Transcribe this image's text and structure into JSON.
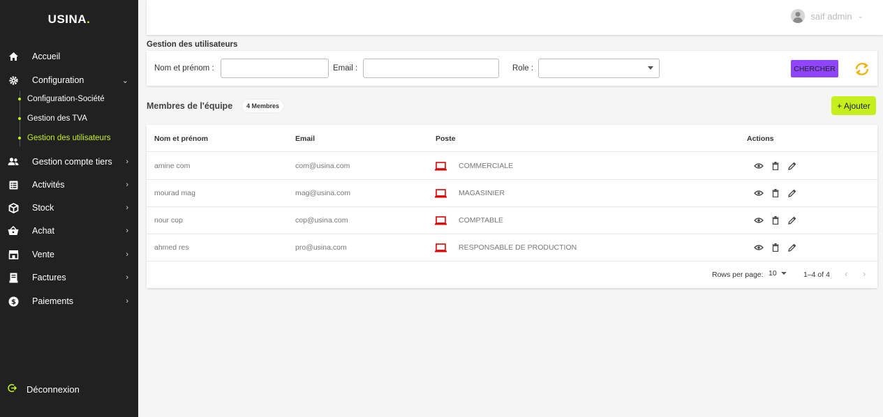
{
  "app": {
    "logo_text": "USINA",
    "logo_dot": "."
  },
  "sidebar": {
    "items": [
      {
        "label": "Accueil",
        "icon": "home-icon"
      },
      {
        "label": "Configuration",
        "icon": "gear-icon",
        "chevron": "⌄"
      },
      {
        "label": "Gestion compte tiers",
        "icon": "users-icon",
        "chevron": "›"
      },
      {
        "label": "Activités",
        "icon": "list-icon",
        "chevron": "›"
      },
      {
        "label": "Stock",
        "icon": "box-icon",
        "chevron": "›"
      },
      {
        "label": "Achat",
        "icon": "basket-icon",
        "chevron": "›"
      },
      {
        "label": "Vente",
        "icon": "store-icon",
        "chevron": "›"
      },
      {
        "label": "Factures",
        "icon": "receipt-icon",
        "chevron": "›"
      },
      {
        "label": "Paiements",
        "icon": "dollar-icon",
        "chevron": "›"
      }
    ],
    "sub_items": [
      {
        "label": "Configuration-Société"
      },
      {
        "label": "Gestion des TVA"
      },
      {
        "label": "Gestion des utilisateurs",
        "active": true
      }
    ],
    "logout_label": "Déconnexion",
    "accent_color": "#c6f01d"
  },
  "topbar": {
    "user_name": "saif admin"
  },
  "page": {
    "title": "Gestion des utilisateurs"
  },
  "filter": {
    "name_label": "Nom et prénom :",
    "name_value": "",
    "email_label": "Email :",
    "email_value": "",
    "role_label": "Role :",
    "role_value": "",
    "search_label": "CHERCHER",
    "search_color": "#8f44fd"
  },
  "team": {
    "title": "Membres de l'équipe",
    "badge": "4 Membres",
    "add_label": "+ Ajouter"
  },
  "table": {
    "headers": {
      "name": "Nom et prénom",
      "email": "Email",
      "poste": "Poste",
      "actions": "Actions"
    },
    "rows": [
      {
        "name": "amine com",
        "email": "com@usina.com",
        "poste": "COMMERCIALE"
      },
      {
        "name": "mourad mag",
        "email": "mag@usina.com",
        "poste": "MAGASINIER"
      },
      {
        "name": "nour cop",
        "email": "cop@usina.com",
        "poste": "COMPTABLE"
      },
      {
        "name": "ahmed res",
        "email": "pro@usina.com",
        "poste": "RESPONSABLE DE PRODUCTION"
      }
    ],
    "poste_icon": "laptop-icon",
    "poste_icon_color": "#e00000",
    "action_icons": [
      "eye-icon",
      "trash-icon",
      "pencil-icon"
    ]
  },
  "pager": {
    "rows_per_page_label": "Rows per page:",
    "rows_per_page_value": "10",
    "range": "1–4 of 4",
    "prev": "‹",
    "next": "›"
  }
}
